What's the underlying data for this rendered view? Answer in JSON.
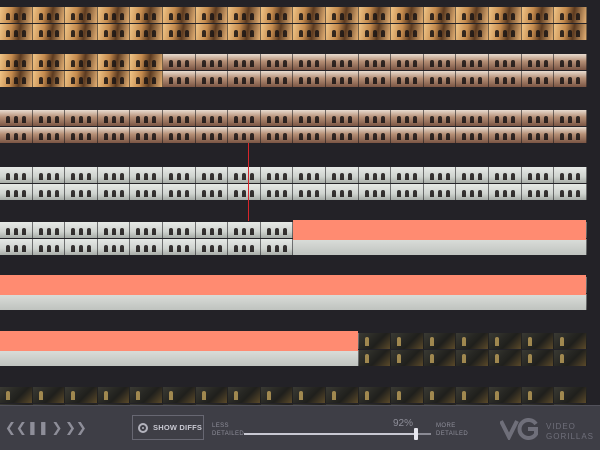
{
  "timeline": {
    "rows": [
      {
        "theme": "amber",
        "highlight": null
      },
      {
        "theme": "amber-to-sepia",
        "highlight": null
      },
      {
        "theme": "sepia",
        "highlight": null
      },
      {
        "theme": "pale",
        "highlight": null
      },
      {
        "theme": "pale",
        "highlight": "right"
      },
      {
        "theme": "pale",
        "highlight": "full"
      },
      {
        "theme": "pale-to-dark",
        "highlight": "left"
      },
      {
        "theme": "dark",
        "highlight": null
      }
    ],
    "colors": {
      "highlight": "#ff8b71",
      "playhead": "#d7262b",
      "background": "#232227",
      "amber": "#c48a4d",
      "sepia": "#a58471",
      "pale": "#d3d6d2",
      "dark": "#2b2b28"
    }
  },
  "controls": {
    "prev_icon": "rewind-icon",
    "pause_icon": "pause-icon",
    "next_icon": "step-forward-icon",
    "forward_icon": "fast-forward-icon",
    "diff_icon": "target-icon",
    "show_diffs_label": "SHOW DIFFS",
    "less_label_1": "LESS",
    "less_label_2": "DETAILED",
    "more_label_1": "MORE",
    "more_label_2": "DETAILED",
    "detail_level": "92%",
    "detail_fraction": 0.92
  },
  "brand": {
    "line1": "VIDEO",
    "line2": "GORILLAS",
    "logo_icon": "vg-logo-icon"
  }
}
